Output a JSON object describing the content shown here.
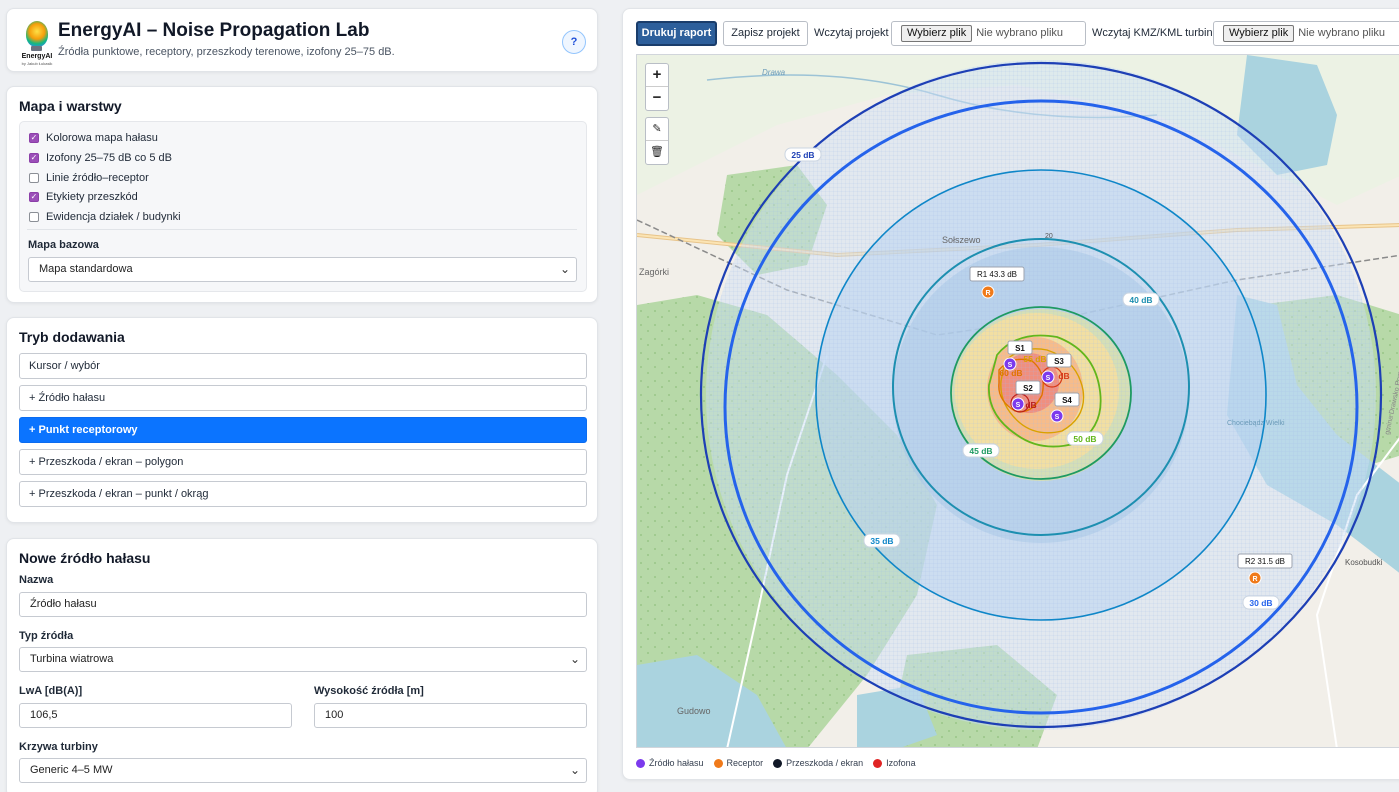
{
  "header": {
    "title": "EnergyAI – Noise Propagation Lab",
    "subtitle": "Źródła punktowe, receptory, przeszkody terenowe, izofony 25–75 dB.",
    "help": "?",
    "logo_text": "EnergyAI",
    "logo_sub": "by Jakub Łukasik"
  },
  "layers": {
    "title": "Mapa i warstwy",
    "items": [
      {
        "label": "Kolorowa mapa hałasu",
        "checked": true
      },
      {
        "label": "Izofony 25–75 dB co 5 dB",
        "checked": true
      },
      {
        "label": "Linie źródło–receptor",
        "checked": false
      },
      {
        "label": "Etykiety przeszkód",
        "checked": true
      },
      {
        "label": "Ewidencja działek / budynki",
        "checked": false
      }
    ],
    "basemap_label": "Mapa bazowa",
    "basemap_value": "Mapa standardowa"
  },
  "mode": {
    "title": "Tryb dodawania",
    "buttons": [
      {
        "label": "Kursor / wybór",
        "active": false
      },
      {
        "label": "+ Źródło hałasu",
        "active": false
      },
      {
        "label": "+ Punkt receptorowy",
        "active": true
      },
      {
        "label": "+ Przeszkoda / ekran – polygon",
        "active": false
      },
      {
        "label": "+ Przeszkoda / ekran – punkt / okrąg",
        "active": false
      }
    ]
  },
  "new_source": {
    "title": "Nowe źródło hałasu",
    "name_label": "Nazwa",
    "name_value": "Źródło hałasu",
    "type_label": "Typ źródła",
    "type_value": "Turbina wiatrowa",
    "lwa_label": "LwA [dB(A)]",
    "lwa_value": "106,5",
    "height_label": "Wysokość źródła [m]",
    "height_value": "100",
    "curve_label": "Krzywa turbiny",
    "curve_value": "Generic 4–5 MW"
  },
  "toolbar": {
    "print": "Drukuj raport",
    "save": "Zapisz projekt",
    "load_label": "Wczytaj projekt",
    "file_btn": "Wybierz plik",
    "no_file": "Nie wybrano pliku",
    "kmz_label": "Wczytaj KMZ/KML turbin",
    "kmz_file_btn": "Wybierz plik",
    "kmz_no_file": "Nie wybrano pliku"
  },
  "map": {
    "zoom_in": "+",
    "zoom_out": "−",
    "edit_icon": "edit-icon",
    "delete_icon": "trash-icon",
    "place_labels": {
      "drawa": "Drawa",
      "zagorki": "Zagórki",
      "solszewo": "Sołszewo",
      "road": "20",
      "gudowo": "Gudowo",
      "kosobudki": "Kosobudki",
      "gmina": "gmina Drawsko Pomorskie",
      "chociebadz": "Chociebądz Wielki"
    },
    "isophones": [
      {
        "label": "25 dB",
        "color": "#1d3fb5"
      },
      {
        "label": "30 dB",
        "color": "#2563eb"
      },
      {
        "label": "35 dB",
        "color": "#0e86c8"
      },
      {
        "label": "40 dB",
        "color": "#1d8fb0"
      },
      {
        "label": "45 dB",
        "color": "#1e9a62"
      },
      {
        "label": "50 dB",
        "color": "#62b61c"
      },
      {
        "label": "55 dB",
        "color": "#d9a100"
      },
      {
        "label": "60 dB",
        "color": "#e07400"
      },
      {
        "label": "dB",
        "color": "#d63a1a"
      },
      {
        "label": "dB",
        "color": "#b91c1c"
      }
    ],
    "sources": [
      {
        "label": "S1",
        "marker": "S"
      },
      {
        "label": "S2",
        "marker": "S"
      },
      {
        "label": "S3",
        "marker": "S"
      },
      {
        "label": "S4",
        "marker": "S"
      }
    ],
    "receptors": [
      {
        "label": "R1 43.3 dB",
        "marker": "R"
      },
      {
        "label": "R2 31.5 dB",
        "marker": "R"
      }
    ],
    "colors": {
      "source": "#7c3aed",
      "receptor": "#f07a1a",
      "obstacle": "#111827",
      "isophone": "#e02424"
    }
  },
  "legend": [
    {
      "label": "Źródło hałasu",
      "color": "#7c3aed"
    },
    {
      "label": "Receptor",
      "color": "#f07a1a"
    },
    {
      "label": "Przeszkoda / ekran",
      "color": "#111827"
    },
    {
      "label": "Izofona",
      "color": "#e02424"
    }
  ]
}
